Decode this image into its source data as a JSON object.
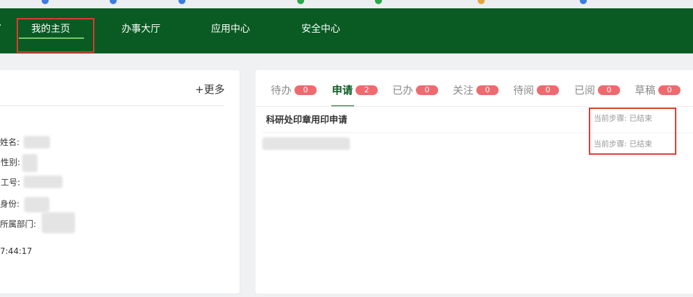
{
  "nav": {
    "items": [
      {
        "label": "我的主页"
      },
      {
        "label": "办事大厅"
      },
      {
        "label": "应用中心"
      },
      {
        "label": "安全中心"
      }
    ],
    "arrow": "·"
  },
  "profile": {
    "more": "+更多",
    "fields": [
      {
        "label": "姓名:"
      },
      {
        "label": "性别:"
      },
      {
        "label": "工号:"
      },
      {
        "label": "身份:"
      },
      {
        "label": "所属部门:"
      }
    ],
    "time": "7:44:17"
  },
  "tabs": [
    {
      "label": "待办",
      "count": "0"
    },
    {
      "label": "申请",
      "count": "2"
    },
    {
      "label": "已办",
      "count": "0"
    },
    {
      "label": "关注",
      "count": "0"
    },
    {
      "label": "待阅",
      "count": "0"
    },
    {
      "label": "已阅",
      "count": "0"
    },
    {
      "label": "草稿",
      "count": "0"
    }
  ],
  "list": {
    "title": "科研处印章用印申请",
    "steps": [
      "当前步骤: 已结束",
      "当前步骤: 已结束"
    ]
  },
  "colors": {
    "nav_bg": "#0a5b23",
    "accent": "#0a5b23",
    "badge": "#ef6a6f",
    "highlight": "#e5372f"
  }
}
